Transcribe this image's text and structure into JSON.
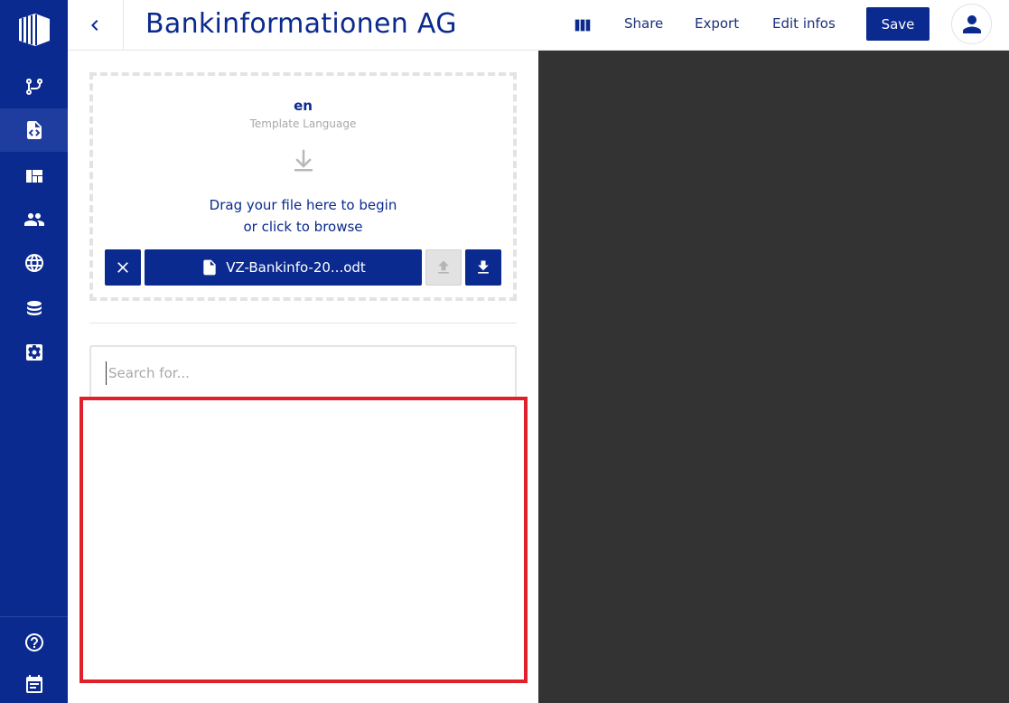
{
  "header": {
    "title": "Bankinformationen AG",
    "columns_icon": "view-columns-icon",
    "share_label": "Share",
    "export_label": "Export",
    "edit_label": "Edit infos",
    "save_label": "Save"
  },
  "sidebar": {
    "items": [
      {
        "icon": "branch-icon",
        "active": false
      },
      {
        "icon": "code-file-icon",
        "active": true
      },
      {
        "icon": "dashboard-icon",
        "active": false
      },
      {
        "icon": "people-icon",
        "active": false
      },
      {
        "icon": "globe-icon",
        "active": false
      },
      {
        "icon": "database-icon",
        "active": false
      },
      {
        "icon": "settings-icon",
        "active": false
      }
    ],
    "bottom": [
      {
        "icon": "help-icon"
      },
      {
        "icon": "calendar-icon"
      }
    ]
  },
  "template": {
    "language_code": "en",
    "language_caption": "Template Language",
    "drop_line1": "Drag your file here to begin",
    "drop_line2": "or click to browse",
    "file_name": "VZ-Bankinfo-20...odt"
  },
  "search": {
    "placeholder": "Search for..."
  },
  "colors": {
    "brand": "#0a2a8f",
    "preview_bg": "#333333",
    "highlight": "#e0202a"
  }
}
